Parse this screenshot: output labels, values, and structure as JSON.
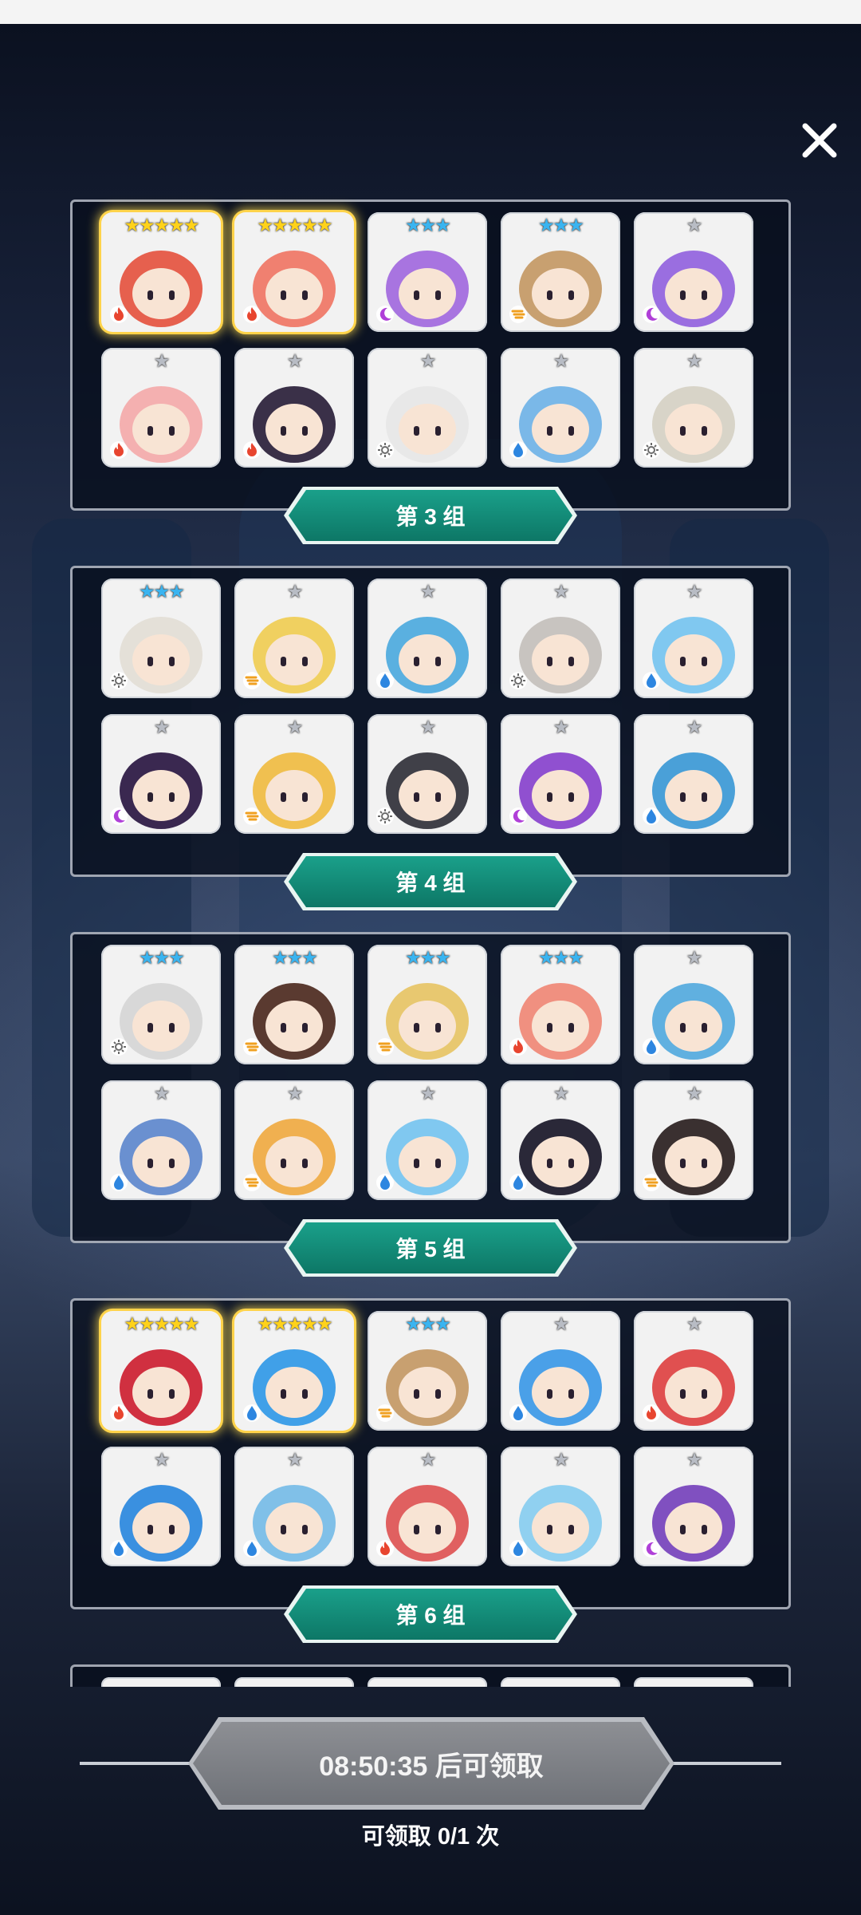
{
  "dialog": {
    "close_icon": "close-icon"
  },
  "groups": [
    {
      "label": "第 3 组",
      "heroes": [
        {
          "stars": 5,
          "star_color": "gold",
          "element": "fire",
          "color": "#e6604e"
        },
        {
          "stars": 5,
          "star_color": "gold",
          "element": "fire",
          "color": "#f08070"
        },
        {
          "stars": 3,
          "star_color": "blue",
          "element": "moon",
          "color": "#a874e0"
        },
        {
          "stars": 3,
          "star_color": "blue",
          "element": "wind",
          "color": "#c8a070"
        },
        {
          "stars": 1,
          "star_color": "silver",
          "element": "moon",
          "color": "#9a6ee0"
        },
        {
          "stars": 1,
          "star_color": "silver",
          "element": "fire",
          "color": "#f4b0b0"
        },
        {
          "stars": 1,
          "star_color": "silver",
          "element": "fire",
          "color": "#3a3048"
        },
        {
          "stars": 1,
          "star_color": "silver",
          "element": "light",
          "color": "#e8e8e8"
        },
        {
          "stars": 1,
          "star_color": "silver",
          "element": "water",
          "color": "#7ab8e8"
        },
        {
          "stars": 1,
          "star_color": "silver",
          "element": "light",
          "color": "#d8d4c8"
        }
      ]
    },
    {
      "label": "第 4 组",
      "heroes": [
        {
          "stars": 3,
          "star_color": "blue",
          "element": "light",
          "color": "#e4e0d8"
        },
        {
          "stars": 1,
          "star_color": "silver",
          "element": "wind",
          "color": "#f0d060"
        },
        {
          "stars": 1,
          "star_color": "silver",
          "element": "water",
          "color": "#5ab0e0"
        },
        {
          "stars": 1,
          "star_color": "silver",
          "element": "light",
          "color": "#c8c4c0"
        },
        {
          "stars": 1,
          "star_color": "silver",
          "element": "water",
          "color": "#80c8f0"
        },
        {
          "stars": 1,
          "star_color": "silver",
          "element": "moon",
          "color": "#3a2850"
        },
        {
          "stars": 1,
          "star_color": "silver",
          "element": "wind",
          "color": "#f0c050"
        },
        {
          "stars": 1,
          "star_color": "silver",
          "element": "light",
          "color": "#404048"
        },
        {
          "stars": 1,
          "star_color": "silver",
          "element": "moon",
          "color": "#9050d0"
        },
        {
          "stars": 1,
          "star_color": "silver",
          "element": "water",
          "color": "#4aa0d8"
        }
      ]
    },
    {
      "label": "第 5 组",
      "heroes": [
        {
          "stars": 3,
          "star_color": "blue",
          "element": "light",
          "color": "#d8d8d8"
        },
        {
          "stars": 3,
          "star_color": "blue",
          "element": "wind",
          "color": "#5a3a30"
        },
        {
          "stars": 3,
          "star_color": "blue",
          "element": "wind",
          "color": "#e8c870"
        },
        {
          "stars": 3,
          "star_color": "blue",
          "element": "fire",
          "color": "#f09080"
        },
        {
          "stars": 1,
          "star_color": "silver",
          "element": "water",
          "color": "#60b0e0"
        },
        {
          "stars": 1,
          "star_color": "silver",
          "element": "water",
          "color": "#6a90d0"
        },
        {
          "stars": 1,
          "star_color": "silver",
          "element": "wind",
          "color": "#f0b050"
        },
        {
          "stars": 1,
          "star_color": "silver",
          "element": "water",
          "color": "#80c8f0"
        },
        {
          "stars": 1,
          "star_color": "silver",
          "element": "water",
          "color": "#2a2838"
        },
        {
          "stars": 1,
          "star_color": "silver",
          "element": "wind",
          "color": "#3a3030"
        }
      ]
    },
    {
      "label": "第 6 组",
      "heroes": [
        {
          "stars": 5,
          "star_color": "gold",
          "element": "fire",
          "color": "#d03040"
        },
        {
          "stars": 5,
          "star_color": "gold",
          "element": "water",
          "color": "#40a0e8"
        },
        {
          "stars": 3,
          "star_color": "blue",
          "element": "wind",
          "color": "#c8a070"
        },
        {
          "stars": 1,
          "star_color": "silver",
          "element": "water",
          "color": "#4aa0e8"
        },
        {
          "stars": 1,
          "star_color": "silver",
          "element": "fire",
          "color": "#e05050"
        },
        {
          "stars": 1,
          "star_color": "silver",
          "element": "water",
          "color": "#3a90e0"
        },
        {
          "stars": 1,
          "star_color": "silver",
          "element": "water",
          "color": "#80c0e8"
        },
        {
          "stars": 1,
          "star_color": "silver",
          "element": "fire",
          "color": "#e06060"
        },
        {
          "stars": 1,
          "star_color": "silver",
          "element": "water",
          "color": "#90d0f0"
        },
        {
          "stars": 1,
          "star_color": "silver",
          "element": "moon",
          "color": "#8050c0"
        }
      ]
    }
  ],
  "claim": {
    "button_label": "08:50:35 后可领取",
    "count_label": "可领取 0/1 次"
  }
}
